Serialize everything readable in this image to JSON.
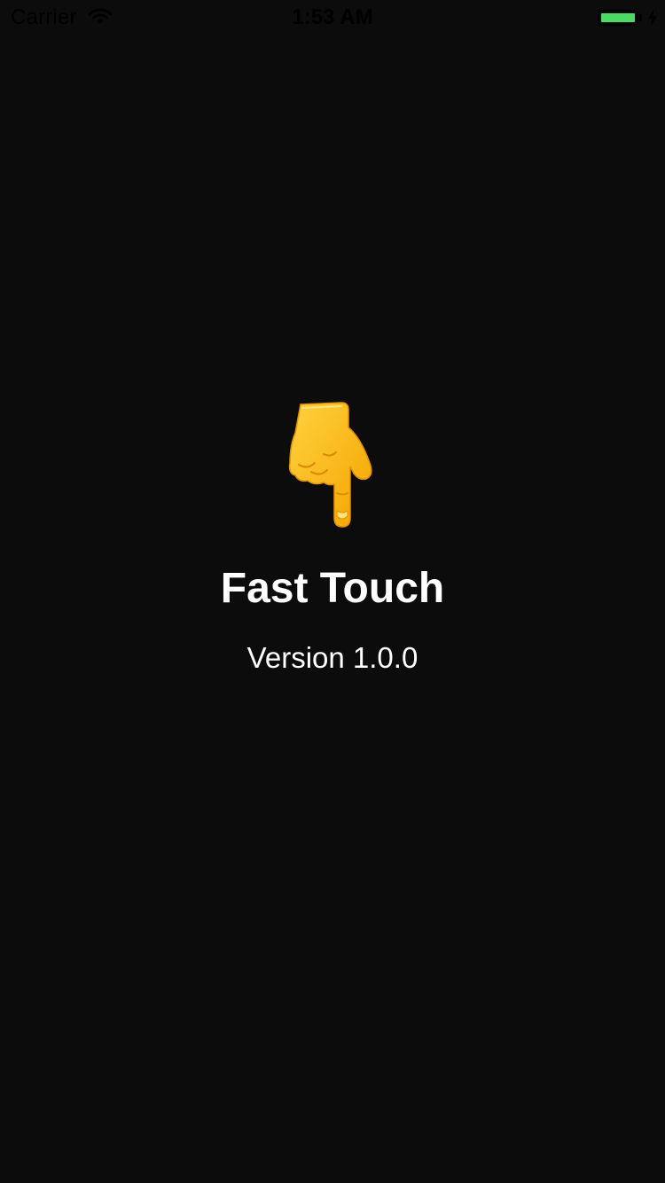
{
  "status_bar": {
    "carrier": "Carrier",
    "time": "1:53 AM",
    "battery_color": "#4cd964",
    "icons": [
      "wifi-icon",
      "battery-icon",
      "charging-icon"
    ]
  },
  "splash": {
    "icon": "backhand-index-pointing-down-icon",
    "title": "Fast Touch",
    "version": "Version 1.0.0"
  },
  "colors": {
    "background": "#0c0c0d",
    "text": "#ffffff"
  }
}
